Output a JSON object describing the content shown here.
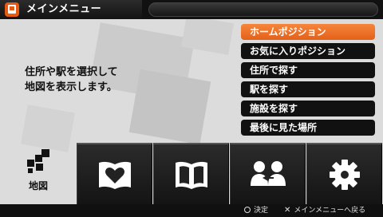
{
  "header": {
    "title": "メインメニュー",
    "app_icon": "navigation-app-icon"
  },
  "description": {
    "lines": [
      "住所や駅を選択して",
      "地図を表示します。"
    ]
  },
  "menu": {
    "items": [
      {
        "label": "ホームポジション",
        "selected": true
      },
      {
        "label": "お気に入りポジション",
        "selected": false
      },
      {
        "label": "住所で探す",
        "selected": false
      },
      {
        "label": "駅を探す",
        "selected": false
      },
      {
        "label": "施設を探す",
        "selected": false
      },
      {
        "label": "最後に見た場所",
        "selected": false
      }
    ]
  },
  "category": {
    "label": "地図",
    "icon": "map-icon"
  },
  "tiles": [
    {
      "icon": "heart-book-icon"
    },
    {
      "icon": "open-book-icon"
    },
    {
      "icon": "people-exchange-icon"
    },
    {
      "icon": "gear-icon"
    }
  ],
  "footer": {
    "confirm": "決定",
    "back": "メインメニューへ戻る",
    "confirm_icon": "circle-button-icon",
    "back_icon": "cross-button-icon"
  },
  "colors": {
    "accent": "#e85a14",
    "panel": "#dcdcdc",
    "item_bg": "#111111"
  }
}
